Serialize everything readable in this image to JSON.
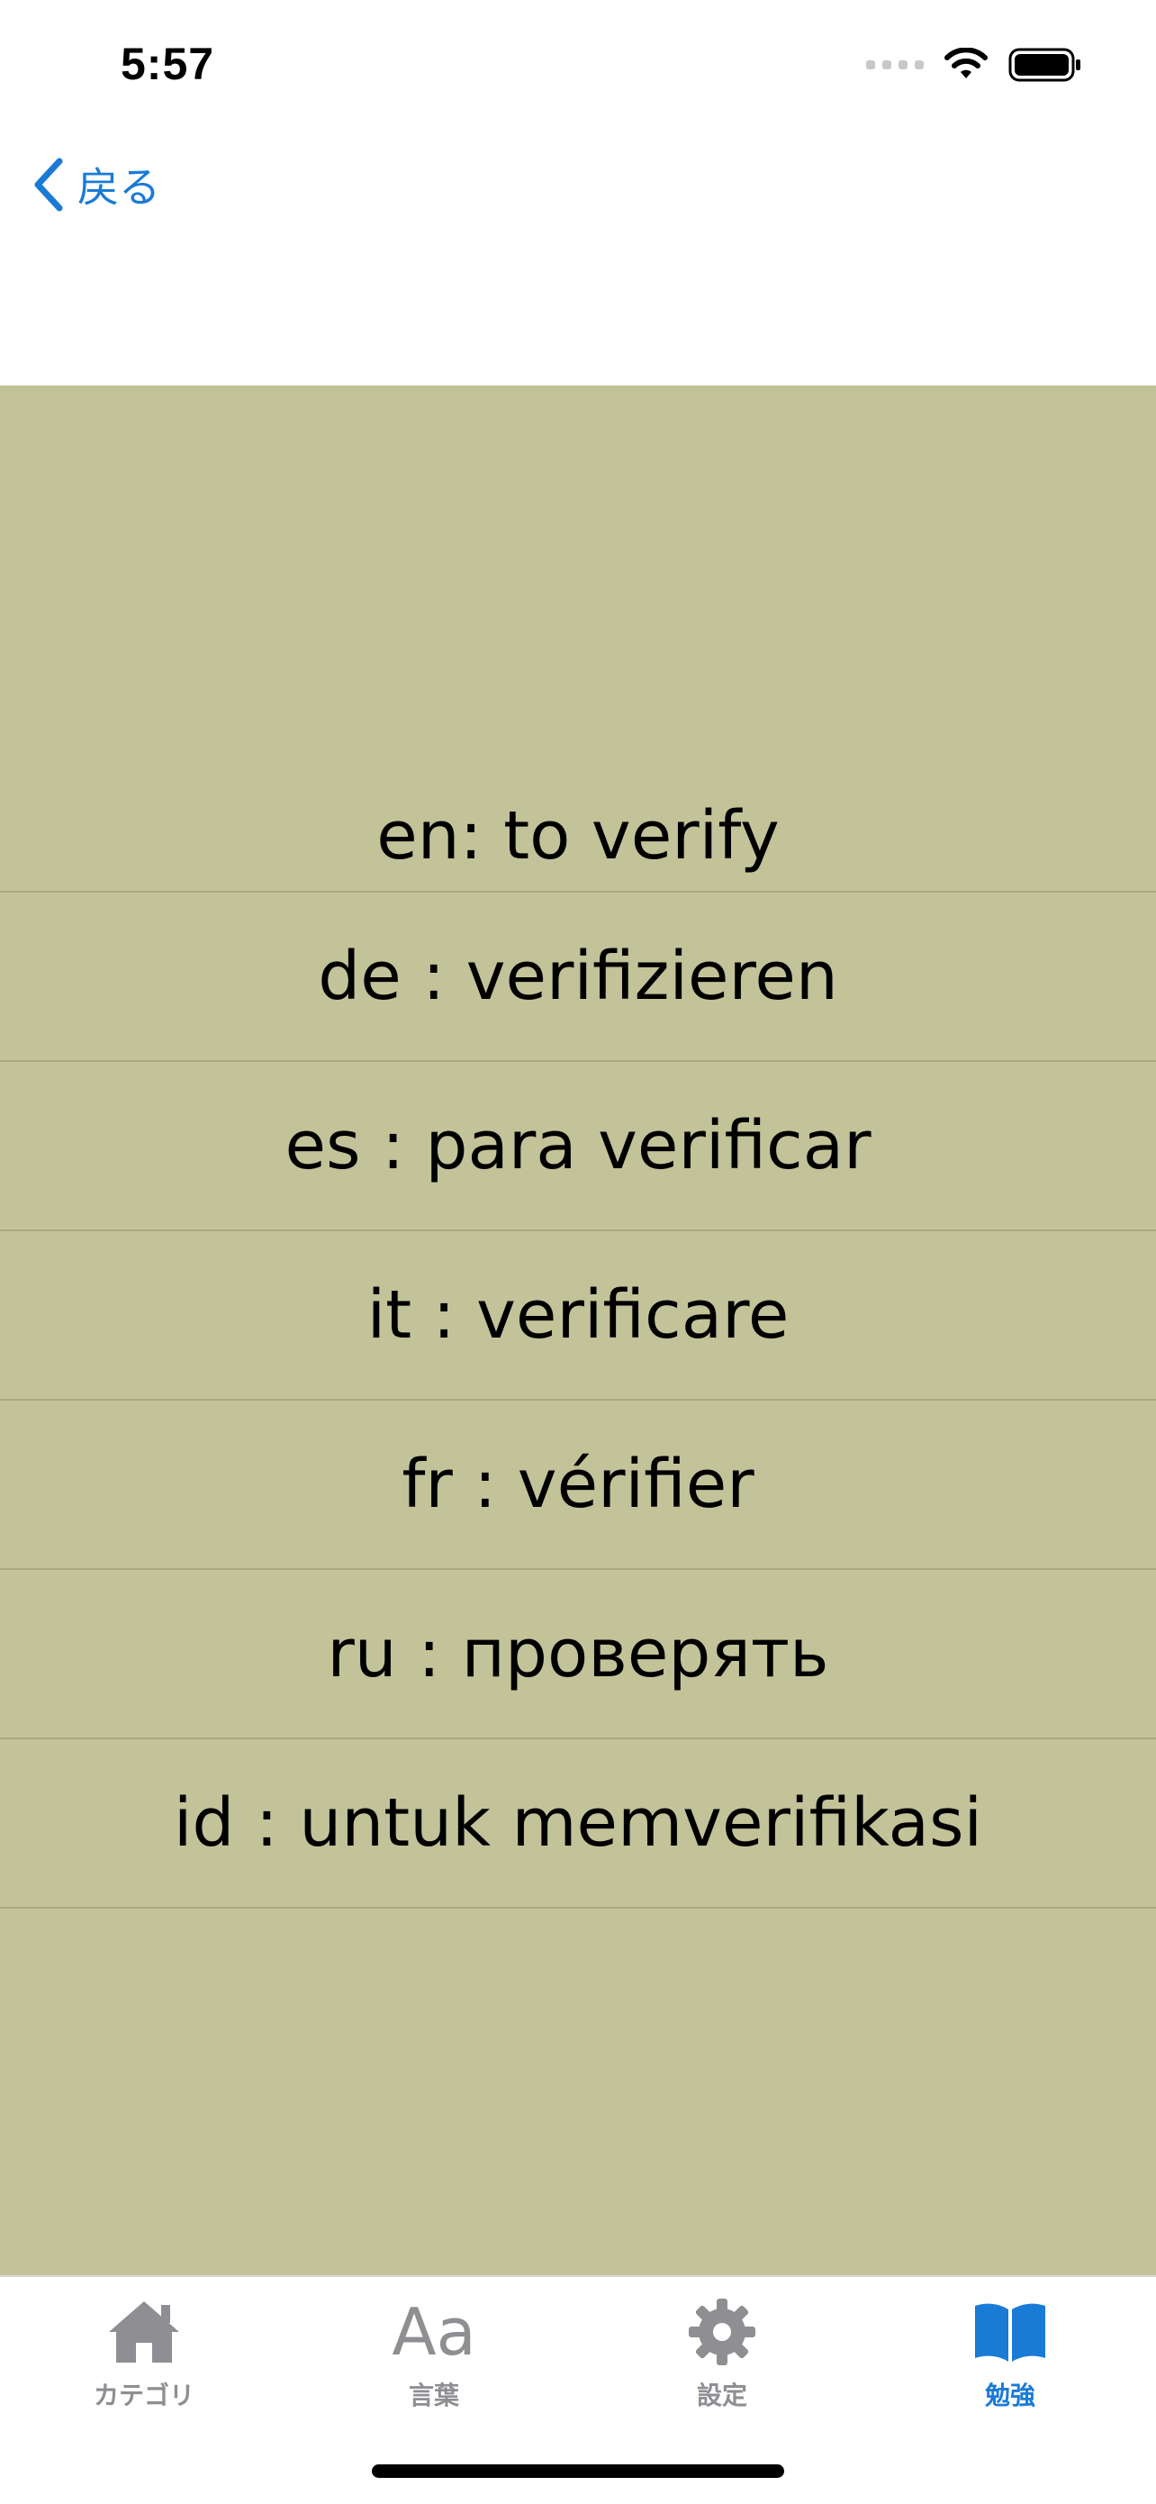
{
  "status_bar": {
    "time": "5:57"
  },
  "nav": {
    "back_label": "戻る"
  },
  "words": [
    {
      "text": "en: to verify"
    },
    {
      "text": "de : verifizieren"
    },
    {
      "text": "es : para verificar"
    },
    {
      "text": "it : verificare"
    },
    {
      "text": "fr : vérifier"
    },
    {
      "text": "ru : проверять"
    },
    {
      "text": "id : untuk memverifikasi"
    }
  ],
  "tabs": [
    {
      "label": "カテゴリ",
      "icon": "home-icon",
      "active": false
    },
    {
      "label": "言葉",
      "icon": "text-format-icon",
      "glyph": "Aa",
      "active": false
    },
    {
      "label": "設定",
      "icon": "gear-icon",
      "active": false
    },
    {
      "label": "勉強",
      "icon": "book-icon",
      "active": true
    }
  ],
  "colors": {
    "accent": "#1a7bd6",
    "content_background": "#c2c399",
    "inactive_tab": "#8e8e93"
  }
}
